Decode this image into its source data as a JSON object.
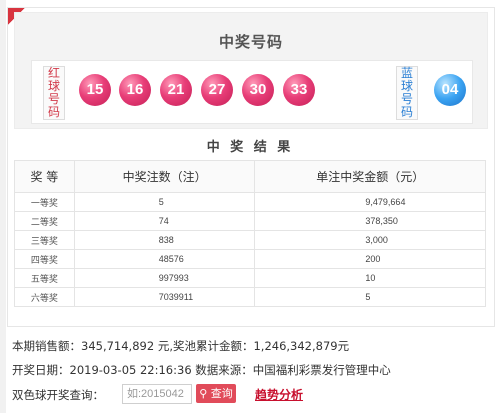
{
  "prize_numbers": {
    "title": "中奖号码",
    "red_label": "红球号码",
    "blue_label": "蓝球号码",
    "red_balls": [
      "15",
      "16",
      "21",
      "27",
      "30",
      "33"
    ],
    "blue_balls": [
      "04"
    ]
  },
  "results": {
    "title": "中 奖 结 果",
    "headers": [
      "奖 等",
      "中奖注数（注）",
      "单注中奖金额（元）"
    ],
    "rows": [
      {
        "level": "一等奖",
        "count": "5",
        "amount": "9,479,664"
      },
      {
        "level": "二等奖",
        "count": "74",
        "amount": "378,350"
      },
      {
        "level": "三等奖",
        "count": "838",
        "amount": "3,000"
      },
      {
        "level": "四等奖",
        "count": "48576",
        "amount": "200"
      },
      {
        "level": "五等奖",
        "count": "997993",
        "amount": "10"
      },
      {
        "level": "六等奖",
        "count": "7039911",
        "amount": "5"
      }
    ]
  },
  "summary": {
    "sales_line": "本期销售额：345,714,892 元,奖池累计金额：1,246,342,879元",
    "draw_line": "开奖日期：2019-03-05 22:16:36 数据来源：中国福利彩票发行管理中心"
  },
  "query": {
    "label": "双色球开奖查询：",
    "placeholder": "如:2015042",
    "button": "查询",
    "trend_link": "趋势分析"
  },
  "colors": {
    "red_ball": "#e83e78",
    "blue_ball": "#3aa3f2",
    "accent": "#e14b5a"
  }
}
